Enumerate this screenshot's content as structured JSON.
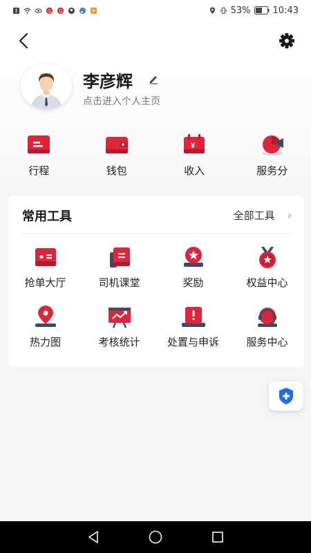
{
  "status_bar": {
    "battery": "53%",
    "time": "10:43"
  },
  "profile": {
    "name": "李彦辉",
    "subtitle": "点击进入个人主页"
  },
  "quick_actions": [
    {
      "label": "行程",
      "icon": "itinerary-icon"
    },
    {
      "label": "钱包",
      "icon": "wallet-icon"
    },
    {
      "label": "收入",
      "icon": "income-icon"
    },
    {
      "label": "服务分",
      "icon": "service-score-icon"
    }
  ],
  "tools": {
    "title": "常用工具",
    "all_label": "全部工具",
    "items": [
      {
        "label": "抢单大厅",
        "icon": "order-hall-icon"
      },
      {
        "label": "司机课堂",
        "icon": "driver-class-icon"
      },
      {
        "label": "奖励",
        "icon": "reward-icon"
      },
      {
        "label": "权益中心",
        "icon": "benefits-icon"
      },
      {
        "label": "热力图",
        "icon": "heatmap-icon"
      },
      {
        "label": "考核统计",
        "icon": "assessment-stats-icon"
      },
      {
        "label": "处置与申诉",
        "icon": "appeal-icon"
      },
      {
        "label": "服务中心",
        "icon": "service-center-icon"
      }
    ]
  },
  "colors": {
    "accent": "#e0243a",
    "accent_dark": "#b81a2c",
    "shield": "#1e6ee8"
  }
}
